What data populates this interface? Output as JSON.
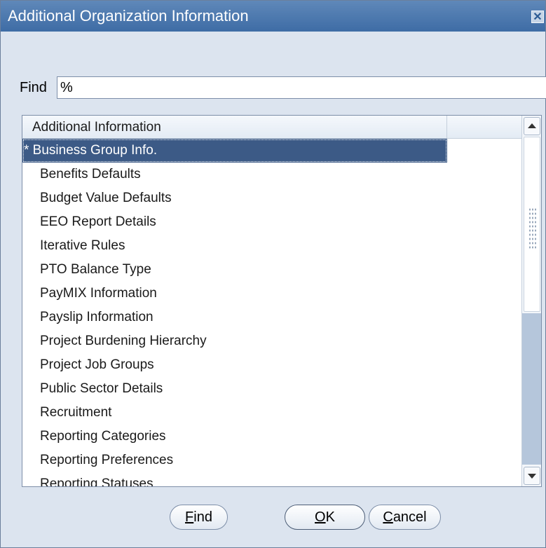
{
  "window": {
    "title": "Additional Organization Information",
    "close_glyph": "✕"
  },
  "find": {
    "label": "Find",
    "value": "%"
  },
  "list": {
    "column_header": "Additional Information",
    "items": [
      "* Business Group Info.",
      "Benefits Defaults",
      "Budget Value Defaults",
      "EEO Report Details",
      "Iterative Rules",
      "PTO Balance Type",
      "PayMIX Information",
      "Payslip Information",
      "Project Burdening Hierarchy",
      "Project Job Groups",
      "Public Sector Details",
      "Recruitment",
      "Reporting Categories",
      "Reporting Preferences",
      "Reporting Statuses"
    ],
    "selected_index": 0
  },
  "buttons": {
    "find_label_u": "F",
    "find_label_rest": "ind",
    "ok_label_u": "O",
    "ok_label_rest": "K",
    "cancel_label_u": "C",
    "cancel_label_rest": "ancel"
  },
  "colors": {
    "titlebar": "#4a77ae",
    "selection": "#3c5a86",
    "background": "#dce4ef"
  }
}
